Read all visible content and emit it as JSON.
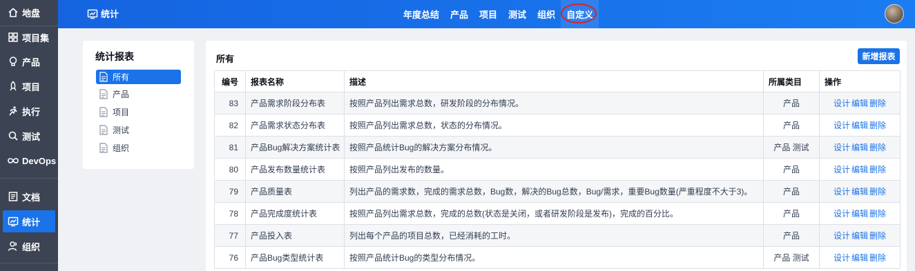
{
  "leftnav": {
    "items": [
      {
        "label": "地盘",
        "icon": "home-icon"
      },
      {
        "label": "项目集",
        "icon": "grid-icon"
      },
      {
        "label": "产品",
        "icon": "bulb-icon"
      },
      {
        "label": "项目",
        "icon": "rocket-icon"
      },
      {
        "label": "执行",
        "icon": "run-icon"
      },
      {
        "label": "测试",
        "icon": "search-icon"
      },
      {
        "label": "DevOps",
        "icon": "infinity-icon"
      },
      {
        "label": "文档",
        "icon": "doc-icon"
      },
      {
        "label": "统计",
        "icon": "chart-icon",
        "active": true
      },
      {
        "label": "组织",
        "icon": "people-icon"
      }
    ]
  },
  "header": {
    "app_title": "统计",
    "tabs": [
      "年度总结",
      "产品",
      "项目",
      "测试",
      "组织",
      "自定义"
    ],
    "active_tab": "自定义"
  },
  "side": {
    "title": "统计报表",
    "items": [
      "所有",
      "产品",
      "项目",
      "测试",
      "组织"
    ],
    "active": "所有"
  },
  "main": {
    "title": "所有",
    "add_button": "新增报表",
    "columns": [
      "编号",
      "报表名称",
      "描述",
      "所属类目",
      "操作"
    ],
    "actions": [
      "设计",
      "编辑",
      "删除"
    ],
    "rows": [
      {
        "id": "83",
        "name": "产品需求阶段分布表",
        "desc": "按照产品列出需求总数，研发阶段的分布情况。",
        "cat": "产品"
      },
      {
        "id": "82",
        "name": "产品需求状态分布表",
        "desc": "按照产品列出需求总数，状态的分布情况。",
        "cat": "产品"
      },
      {
        "id": "81",
        "name": "产品Bug解决方案统计表",
        "desc": "按照产品统计Bug的解决方案分布情况。",
        "cat": "产品 测试"
      },
      {
        "id": "80",
        "name": "产品发布数量统计表",
        "desc": "按照产品列出发布的数量。",
        "cat": "产品"
      },
      {
        "id": "79",
        "name": "产品质量表",
        "desc": "列出产品的需求数，完成的需求总数，Bug数，解决的Bug总数，Bug/需求，重要Bug数量(严重程度不大于3)。",
        "cat": "产品"
      },
      {
        "id": "78",
        "name": "产品完成度统计表",
        "desc": "按照产品列出需求总数，完成的总数(状态是关闭，或者研发阶段是发布)，完成的百分比。",
        "cat": "产品"
      },
      {
        "id": "77",
        "name": "产品投入表",
        "desc": "列出每个产品的项目总数，已经消耗的工时。",
        "cat": "产品"
      },
      {
        "id": "76",
        "name": "产品Bug类型统计表",
        "desc": "按照产品统计Bug的类型分布情况。",
        "cat": "产品 测试"
      }
    ]
  }
}
